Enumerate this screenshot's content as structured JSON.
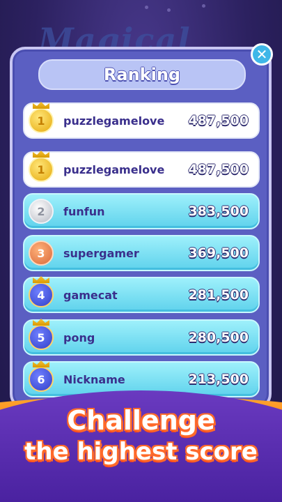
{
  "background": {
    "logo_text": "Magical"
  },
  "panel": {
    "title": "Ranking",
    "close_icon": "close-icon"
  },
  "my_rank": {
    "rank": "1",
    "name": "puzzlegamelove",
    "score": "487,500",
    "medal": "gold"
  },
  "rankings": [
    {
      "rank": "1",
      "name": "puzzlegamelove",
      "score": "487,500",
      "medal": "gold"
    },
    {
      "rank": "2",
      "name": "funfun",
      "score": "383,500",
      "medal": "silver"
    },
    {
      "rank": "3",
      "name": "supergamer",
      "score": "369,500",
      "medal": "bronze"
    },
    {
      "rank": "4",
      "name": "gamecat",
      "score": "281,500",
      "medal": "blue"
    },
    {
      "rank": "5",
      "name": "pong",
      "score": "280,500",
      "medal": "blue"
    },
    {
      "rank": "6",
      "name": "Nickname",
      "score": "213,500",
      "medal": "blue"
    }
  ],
  "promo": {
    "line1": "Challenge",
    "line2": "the highest score"
  },
  "colors": {
    "panel": "#5b5fc2",
    "row_highlight": "#ffffff",
    "row": "#6dd8ef",
    "promo_accent": "#ff6a2a"
  }
}
